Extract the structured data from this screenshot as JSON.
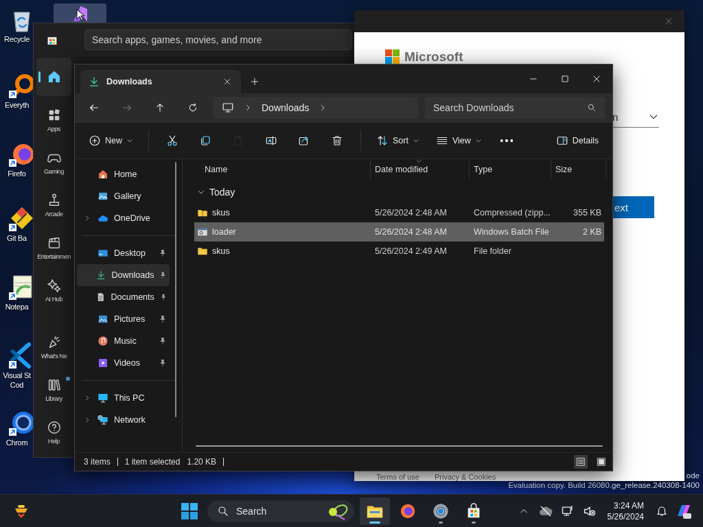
{
  "desktop": {
    "icons": [
      {
        "label_lines": [
          "Recycle"
        ],
        "shortcut": false
      },
      {
        "label_lines": [
          "Everyth"
        ],
        "shortcut": true
      },
      {
        "label_lines": [
          "Firefo"
        ],
        "shortcut": true
      },
      {
        "label_lines": [
          "Git Ba"
        ],
        "shortcut": true
      },
      {
        "label_lines": [
          "Notepa"
        ],
        "shortcut": true
      },
      {
        "label_lines": [
          "Visual St",
          "Cod"
        ],
        "shortcut": true
      },
      {
        "label_lines": [
          "Chrom"
        ],
        "shortcut": true
      }
    ],
    "top_icon": {
      "selected": true
    },
    "watermark_lines": [
      "ode",
      "Evaluation copy. Build 26080.ge_release.240308-1400"
    ]
  },
  "store": {
    "search": {
      "placeholder": "Search apps, games, movies, and more"
    },
    "nav": [
      {
        "selected": true,
        "notification": false
      },
      {
        "label": "Apps",
        "selected": false,
        "notification": false
      },
      {
        "label": "Gaming",
        "selected": false,
        "notification": false
      },
      {
        "label": "Arcade",
        "selected": false,
        "notification": false
      },
      {
        "label": "Entertainmen",
        "selected": false,
        "notification": false
      },
      {
        "label": "AI Hub",
        "selected": false,
        "notification": false
      },
      {
        "label": "What's Ne",
        "selected": false,
        "notification": false
      },
      {
        "label": "Library",
        "selected": false,
        "notification": true
      },
      {
        "label": "Help",
        "selected": false,
        "notification": false
      }
    ]
  },
  "ms_window": {
    "logo_text": "Microsoft",
    "field_value": "n",
    "button": "ext",
    "links": [
      "Terms of use",
      "Privacy & Cookies"
    ]
  },
  "explorer": {
    "tabs": [
      {
        "label": "Downloads",
        "selected": true
      }
    ],
    "nav_buttons": [
      {
        "disabled": false
      },
      {
        "disabled": true
      },
      {
        "disabled": false
      },
      {
        "disabled": false
      }
    ],
    "breadcrumb": [
      "Downloads"
    ],
    "search": {
      "placeholder": "Search Downloads"
    },
    "toolbar": {
      "new": "New",
      "actions": [
        {
          "disabled": false
        },
        {
          "disabled": false
        },
        {
          "disabled": true
        },
        {
          "disabled": false
        },
        {
          "disabled": false
        },
        {
          "disabled": false
        }
      ],
      "sort": "Sort",
      "view": "View",
      "details": "Details"
    },
    "sidebar": [
      [
        {
          "label": "Home",
          "selected": false,
          "pinned": false,
          "expandable": false
        },
        {
          "label": "Gallery",
          "selected": false,
          "pinned": false,
          "expandable": false
        },
        {
          "label": "OneDrive",
          "selected": false,
          "pinned": false,
          "expandable": true
        }
      ],
      [
        {
          "label": "Desktop",
          "selected": false,
          "pinned": true,
          "expandable": false
        },
        {
          "label": "Downloads",
          "selected": true,
          "pinned": true,
          "expandable": false
        },
        {
          "label": "Documents",
          "selected": false,
          "pinned": true,
          "expandable": false
        },
        {
          "label": "Pictures",
          "selected": false,
          "pinned": true,
          "expandable": false
        },
        {
          "label": "Music",
          "selected": false,
          "pinned": true,
          "expandable": false
        },
        {
          "label": "Videos",
          "selected": false,
          "pinned": true,
          "expandable": false
        }
      ],
      [
        {
          "label": "This PC",
          "selected": false,
          "pinned": false,
          "expandable": true
        },
        {
          "label": "Network",
          "selected": false,
          "pinned": false,
          "expandable": true
        }
      ]
    ],
    "columns": [
      {
        "label": "Name",
        "sorted": false
      },
      {
        "label": "Date modified",
        "sorted": true
      },
      {
        "label": "Type",
        "sorted": false
      },
      {
        "label": "Size",
        "sorted": false
      }
    ],
    "group": {
      "label": "Today",
      "expanded": true
    },
    "rows": [
      {
        "kind": "zip",
        "name": "skus",
        "date": "5/26/2024 2:48 AM",
        "type": "Compressed (zipp...",
        "size": "355 KB",
        "selected": false
      },
      {
        "kind": "batch",
        "name": "loader",
        "date": "5/26/2024 2:48 AM",
        "type": "Windows Batch File",
        "size": "2 KB",
        "selected": true
      },
      {
        "kind": "folder",
        "name": "skus",
        "date": "5/26/2024 2:49 AM",
        "type": "File folder",
        "selected": false
      }
    ],
    "status": {
      "count": "3 items",
      "selection": "1 item selected",
      "size": "1.20 KB"
    },
    "view_modes": [
      {
        "selected": true
      },
      {
        "selected": false
      }
    ]
  },
  "taskbar": {
    "search": {
      "placeholder": "Search"
    },
    "apps": [
      {
        "active": true,
        "running": true
      },
      {
        "active": false,
        "running": false
      },
      {
        "active": false,
        "running": true
      },
      {
        "active": false,
        "running": true
      }
    ],
    "time": "3:24 AM",
    "date": "5/26/2024"
  }
}
